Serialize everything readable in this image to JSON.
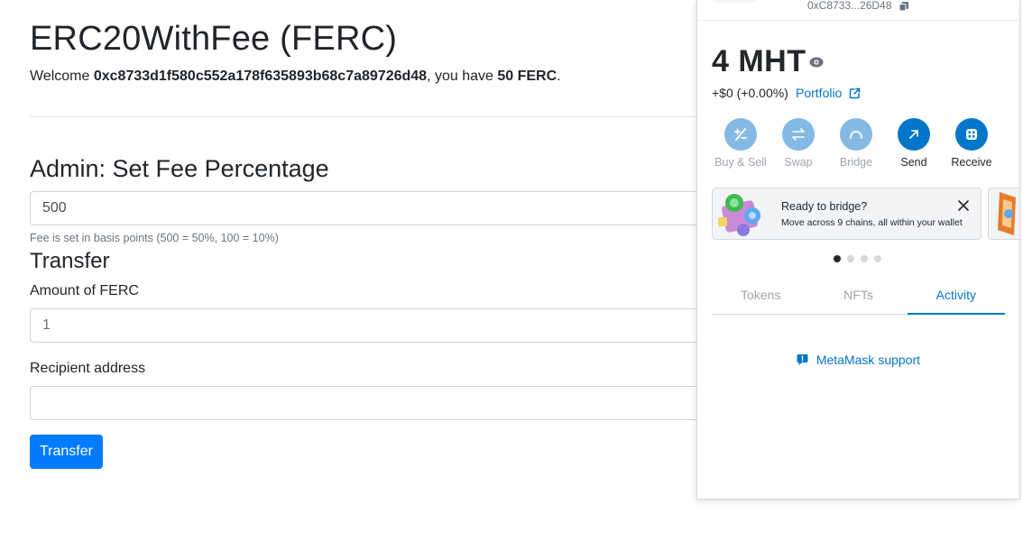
{
  "dapp": {
    "title": "ERC20WithFee (FERC)",
    "welcome": {
      "prefix": "Welcome ",
      "address": "0xc8733d1f580c552a178f635893b68c7a89726d48",
      "middle": ", you have ",
      "balance": "50 FERC",
      "suffix": "."
    },
    "admin": {
      "heading": "Admin: Set Fee Percentage",
      "fee_value": "500",
      "help": "Fee is set in basis points (500 = 50%, 100 = 10%)"
    },
    "transfer": {
      "heading": "Transfer",
      "amount_label": "Amount of FERC",
      "amount_value": "1",
      "recipient_label": "Recipient address",
      "recipient_value": "",
      "button_label": "Transfer"
    }
  },
  "metamask": {
    "account_address": "0xC8733...26D48",
    "balance": "4 MHT",
    "change": "+$0 (+0.00%)",
    "portfolio_label": "Portfolio",
    "actions": [
      {
        "label": "Buy & Sell",
        "icon": "buy-sell-icon",
        "enabled": false
      },
      {
        "label": "Swap",
        "icon": "swap-icon",
        "enabled": false
      },
      {
        "label": "Bridge",
        "icon": "bridge-icon",
        "enabled": false
      },
      {
        "label": "Send",
        "icon": "send-icon",
        "enabled": true
      },
      {
        "label": "Receive",
        "icon": "receive-icon",
        "enabled": true
      }
    ],
    "banner": {
      "title": "Ready to bridge?",
      "subtitle": "Move across 9 chains, all within your wallet"
    },
    "carousel": {
      "count": 4,
      "active": 1
    },
    "tabs": [
      {
        "label": "Tokens",
        "active": false
      },
      {
        "label": "NFTs",
        "active": false
      },
      {
        "label": "Activity",
        "active": true
      }
    ],
    "support_label": "MetaMask support"
  },
  "colors": {
    "primary": "#007bff",
    "metamask_blue": "#0376c9",
    "metamask_blue_disabled": "#84b9e4",
    "muted": "#6c757d"
  }
}
